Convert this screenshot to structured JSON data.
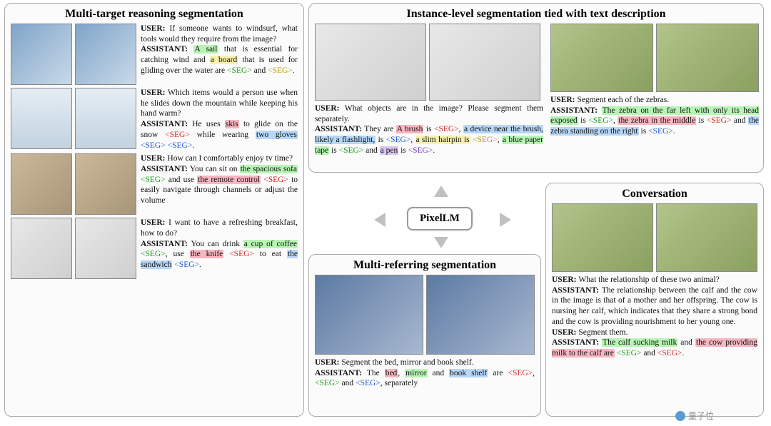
{
  "center_label": "PixelLM",
  "watermark_text": "量子位",
  "panels": {
    "multi_target": {
      "title": "Multi-target reasoning segmentation",
      "rows": [
        {
          "user": "If someone wants to windsurf, what tools would they require from the image?",
          "assistant_pre": "",
          "spans": [
            {
              "t": "A sail",
              "c": "green"
            },
            {
              "t": " that is essential for catching wind and "
            },
            {
              "t": "a board",
              "c": "yellow"
            },
            {
              "t": " that is used for gliding over the water are "
            },
            {
              "seg": "green"
            },
            {
              "t": " and "
            },
            {
              "seg": "yellow"
            },
            {
              "t": "."
            }
          ]
        },
        {
          "user": "Which items would a person use when he slides down the mountain while keeping his hand warm?",
          "spans": [
            {
              "t": "He uses "
            },
            {
              "t": "skis",
              "c": "pink"
            },
            {
              "t": " to glide on the snow "
            },
            {
              "seg": "red"
            },
            {
              "t": " while wearing "
            },
            {
              "t": "two gloves",
              "c": "blue"
            },
            {
              "t": " "
            },
            {
              "seg": "blue"
            },
            {
              "t": " "
            },
            {
              "seg": "blue"
            },
            {
              "t": "."
            }
          ]
        },
        {
          "user": "How can I comfortably enjoy tv time?",
          "spans": [
            {
              "t": "You can sit on "
            },
            {
              "t": "the spacious sofa",
              "c": "green"
            },
            {
              "t": " "
            },
            {
              "seg": "green"
            },
            {
              "t": " and use "
            },
            {
              "t": "the remote control",
              "c": "pink"
            },
            {
              "t": " "
            },
            {
              "seg": "red"
            },
            {
              "t": " to easily navigate through channels or adjust the volume"
            }
          ]
        },
        {
          "user": "I want to have a refreshing breakfast, how to do?",
          "spans": [
            {
              "t": "You can drink "
            },
            {
              "t": "a cup of coffee",
              "c": "green"
            },
            {
              "t": " "
            },
            {
              "seg": "green"
            },
            {
              "t": ", use "
            },
            {
              "t": "the knife",
              "c": "pink"
            },
            {
              "t": " "
            },
            {
              "seg": "red"
            },
            {
              "t": " to eat "
            },
            {
              "t": "the sandwich",
              "c": "blue"
            },
            {
              "t": " "
            },
            {
              "seg": "blue"
            },
            {
              "t": "."
            }
          ]
        }
      ]
    },
    "instance": {
      "title": "Instance-level  segmentation tied with text description",
      "left": {
        "user": "What objects are in the image? Please segment them separately.",
        "spans": [
          {
            "t": "They are "
          },
          {
            "t": "A brush",
            "c": "pink"
          },
          {
            "t": " is "
          },
          {
            "seg": "red"
          },
          {
            "t": ", "
          },
          {
            "t": "a device near the brush, likely a flashlight,",
            "c": "blue"
          },
          {
            "t": " is "
          },
          {
            "seg": "blue"
          },
          {
            "t": ", "
          },
          {
            "t": "a slim hairpin is",
            "c": "yellow"
          },
          {
            "t": " "
          },
          {
            "seg": "yellow"
          },
          {
            "t": ", "
          },
          {
            "t": "a blue paper tape",
            "c": "green"
          },
          {
            "t": " is "
          },
          {
            "seg": "green"
          },
          {
            "t": " and "
          },
          {
            "t": "a pen",
            "c": "purple"
          },
          {
            "t": " is "
          },
          {
            "seg": "purple"
          },
          {
            "t": "."
          }
        ]
      },
      "right": {
        "user": "Segment each of the zebras.",
        "spans": [
          {
            "t": "The zebra on the far left with only its head exposed",
            "c": "green"
          },
          {
            "t": " is "
          },
          {
            "seg": "green"
          },
          {
            "t": ", "
          },
          {
            "t": "the  zebra in the middle",
            "c": "pink"
          },
          {
            "t": " is "
          },
          {
            "seg": "red"
          },
          {
            "t": " and "
          },
          {
            "t": "the zebra standing on the right",
            "c": "blue"
          },
          {
            "t": " is "
          },
          {
            "seg": "blue"
          },
          {
            "t": "."
          }
        ]
      }
    },
    "multi_ref": {
      "title": "Multi-referring segmentation",
      "user": "Segment the bed, mirror and book shelf.",
      "spans": [
        {
          "t": "The "
        },
        {
          "t": "bed",
          "c": "pink"
        },
        {
          "t": ", "
        },
        {
          "t": "mirror",
          "c": "green"
        },
        {
          "t": " and "
        },
        {
          "t": "book shelf",
          "c": "blue"
        },
        {
          "t": " are "
        },
        {
          "seg": "red"
        },
        {
          "t": ", "
        },
        {
          "seg": "green"
        },
        {
          "t": " and "
        },
        {
          "seg": "blue"
        },
        {
          "t": ", separately"
        }
      ]
    },
    "conversation": {
      "title": "Conversation",
      "turns": [
        {
          "role": "USER",
          "plain": "What the relationship of these two animal?"
        },
        {
          "role": "ASSISTANT",
          "plain": "The relationship between the calf and the cow in the image is that of a mother and her offspring. The cow is nursing her calf, which indicates that they share a strong bond and the cow is providing nourishment to her young one."
        },
        {
          "role": "USER",
          "plain": "Segment them."
        },
        {
          "role": "ASSISTANT",
          "spans": [
            {
              "t": "The calf sucking milk",
              "c": "green"
            },
            {
              "t": " and "
            },
            {
              "t": "the cow providing milk to the calf are",
              "c": "pink"
            },
            {
              "t": " "
            },
            {
              "seg": "green"
            },
            {
              "t": " and "
            },
            {
              "seg": "red"
            },
            {
              "t": "."
            }
          ]
        }
      ]
    }
  },
  "labels": {
    "user": "USER:",
    "assistant": "ASSISTANT:"
  }
}
